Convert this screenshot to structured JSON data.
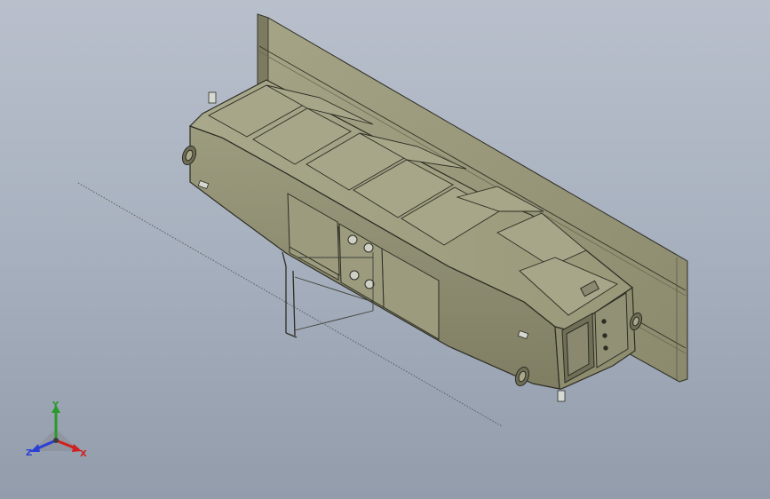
{
  "viewport": {
    "background_top": "#b9c0cc",
    "background_bottom": "#929cab"
  },
  "model": {
    "body_color": "#8d8c70",
    "panel_color": "#a2a184",
    "edge_color": "#2d2d24",
    "wall_color": "#9a9879"
  },
  "triad": {
    "x_label": "X",
    "y_label": "Y",
    "z_label": "Z",
    "x_color": "#d02020",
    "y_color": "#2a9a2a",
    "z_color": "#2a3fd6"
  }
}
